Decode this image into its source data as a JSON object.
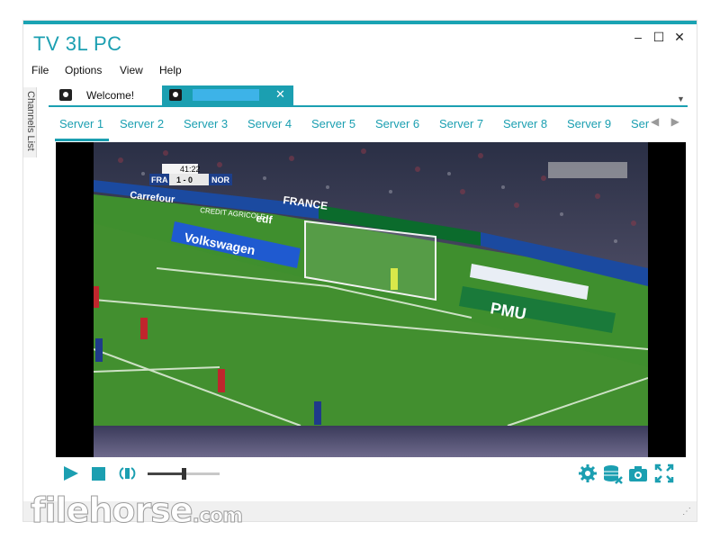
{
  "window": {
    "title": "TV 3L PC",
    "min": "–",
    "max": "☐",
    "close": "✕"
  },
  "menu": [
    "File",
    "Options",
    "View",
    "Help"
  ],
  "sidebar": {
    "label": "Channels List"
  },
  "doc_tabs": {
    "welcome": "Welcome!",
    "active_close": "✕",
    "dropdown": "▼"
  },
  "servers": [
    "Server 1",
    "Server 2",
    "Server 3",
    "Server 4",
    "Server 5",
    "Server 6",
    "Server 7",
    "Server 8",
    "Server 9",
    "Ser"
  ],
  "server_nav": {
    "prev": "◀",
    "next": "▶"
  },
  "scoreboard": {
    "time": "41:22",
    "home": "FRA",
    "score": "1 - 0",
    "away": "NOR"
  },
  "ads": [
    "Volkswagen",
    "PMU",
    "FRANCE",
    "edf",
    "Carrefour",
    "CREDIT AGRICOLE"
  ],
  "volume_fraction": 0.5,
  "watermark": {
    "main": "filehorse",
    "suffix": ".com"
  },
  "colors": {
    "accent": "#1b9fb1",
    "title_border": "#1aa3b3",
    "pitch": "#3f8f2e",
    "blur": "#3db3e8"
  },
  "icons": [
    "play-icon",
    "stop-icon",
    "volume-icon",
    "settings-gear-icon",
    "database-icon",
    "snapshot-camera-icon",
    "fullscreen-icon"
  ]
}
